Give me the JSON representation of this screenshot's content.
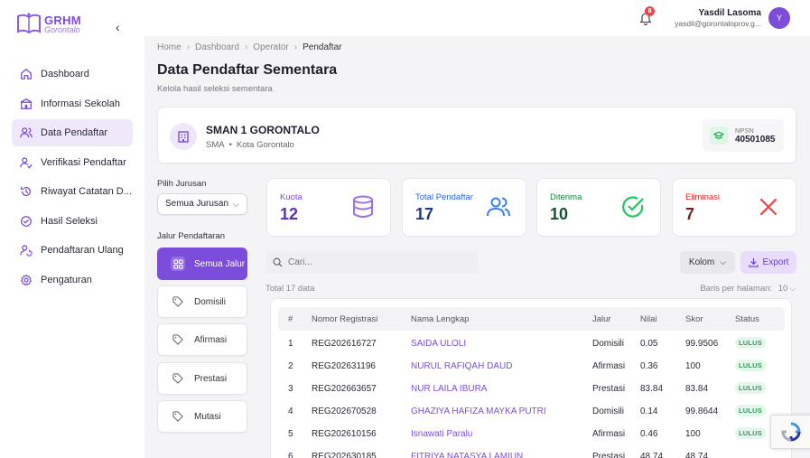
{
  "brand": {
    "title": "GRHM",
    "subtitle": "Gorontalo"
  },
  "sidebar": {
    "items": [
      {
        "label": "Dashboard",
        "icon": "home-icon"
      },
      {
        "label": "Informasi Sekolah",
        "icon": "school-icon"
      },
      {
        "label": "Data Pendaftar",
        "icon": "users-icon",
        "active": true
      },
      {
        "label": "Verifikasi Pendaftar",
        "icon": "user-check-icon"
      },
      {
        "label": "Riwayat Catatan D...",
        "icon": "history-icon"
      },
      {
        "label": "Hasil Seleksi",
        "icon": "check-circle-icon"
      },
      {
        "label": "Pendaftaran Ulang",
        "icon": "refresh-user-icon"
      },
      {
        "label": "Pengaturan",
        "icon": "gear-icon"
      }
    ]
  },
  "header": {
    "notification_count": "8",
    "user_name": "Yasdil Lasoma",
    "user_email": "yasdil@gorontaloprov.g...",
    "avatar_initial": "Y"
  },
  "breadcrumb": {
    "items": [
      "Home",
      "Dashboard",
      "Operator"
    ],
    "current": "Pendaftar"
  },
  "page": {
    "title": "Data Pendaftar Sementara",
    "subtitle": "Kelola hasil seleksi sementara"
  },
  "school": {
    "name": "SMAN 1 GORONTALO",
    "level": "SMA",
    "city": "Kota Gorontalo",
    "npsn_label": "NPSN",
    "npsn_value": "40501085"
  },
  "filters": {
    "jurusan_label": "Pilih Jurusan",
    "jurusan_value": "Semua Jurusan",
    "jalur_label": "Jalur Pendaftaran",
    "jalur_options": [
      "Semua Jalur",
      "Domisili",
      "Afirmasi",
      "Prestasi",
      "Mutasi"
    ]
  },
  "stats": [
    {
      "label": "Kuota",
      "value": "12",
      "color": "#7c4ddb",
      "icon": "database-icon"
    },
    {
      "label": "Total Pendaftar",
      "value": "17",
      "color": "#2563eb",
      "icon": "users-icon"
    },
    {
      "label": "Diterima",
      "value": "10",
      "color": "#16a34a",
      "icon": "check-circle-icon"
    },
    {
      "label": "Eliminasi",
      "value": "7",
      "color": "#dc2626",
      "icon": "x-icon"
    }
  ],
  "toolbar": {
    "search_placeholder": "Cari...",
    "kolom_label": "Kolom",
    "export_label": "Export",
    "total_text": "Total 17 data",
    "per_page_label": "Baris per halaman:",
    "per_page_value": "10"
  },
  "table": {
    "headers": [
      "#",
      "Nomor Registrasi",
      "Nama Lengkap",
      "Jalur",
      "Nilai",
      "Skor",
      "Status"
    ],
    "rows": [
      [
        "1",
        "REG202616727",
        "SAIDA ULOLI",
        "Domisili",
        "0.05",
        "99.9506",
        "LULUS"
      ],
      [
        "2",
        "REG202631196",
        "NURUL RAFIQAH DAUD",
        "Afirmasi",
        "0.36",
        "100",
        "LULUS"
      ],
      [
        "3",
        "REG202663657",
        "NUR LAILA IBURA",
        "Prestasi",
        "83.84",
        "83.84",
        "LULUS"
      ],
      [
        "4",
        "REG202670528",
        "GHAZIYA HAFIZA MAYKA PUTRI",
        "Domisili",
        "0.14",
        "99.8644",
        "LULUS"
      ],
      [
        "5",
        "REG202610156",
        "Isnawati Paralu",
        "Afirmasi",
        "0.46",
        "100",
        "LULUS"
      ],
      [
        "6",
        "REG202630185",
        "FITRIYA NATASYA LAMIUN",
        "Prestasi",
        "48.74",
        "48.74",
        ""
      ]
    ]
  }
}
